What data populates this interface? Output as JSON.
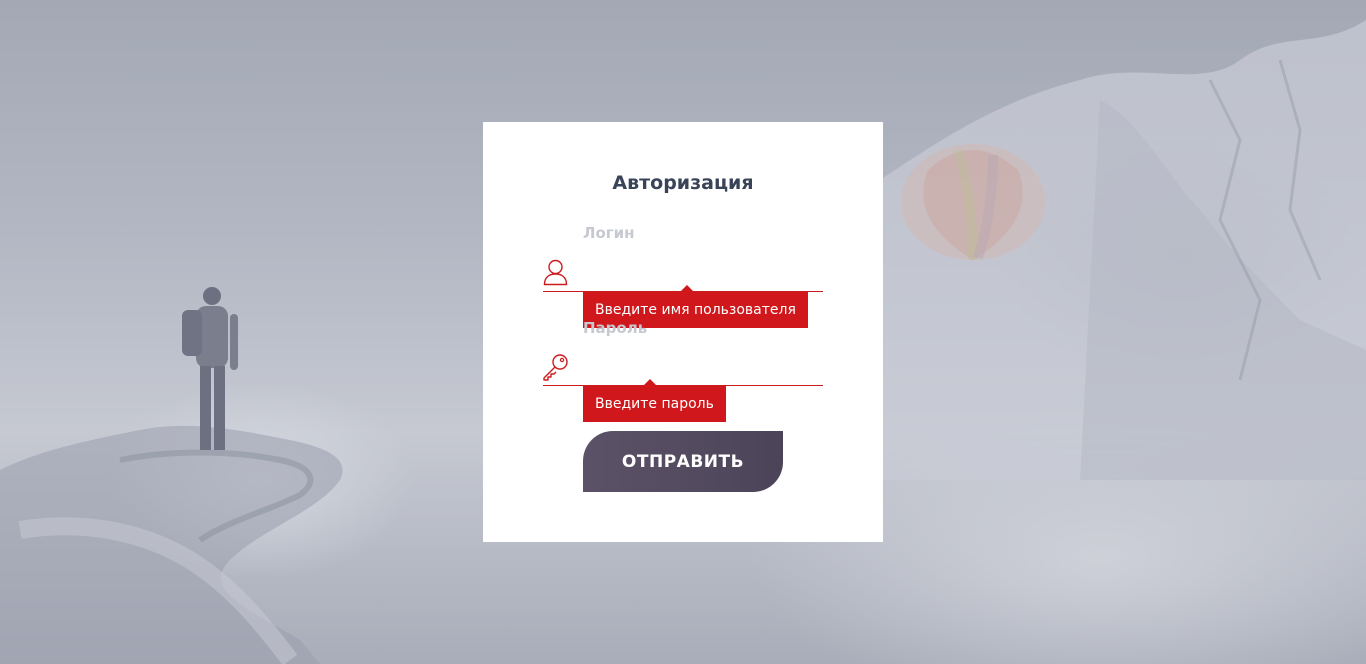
{
  "form": {
    "title": "Авторизация",
    "login": {
      "label": "Логин",
      "value": "",
      "error": "Введите имя пользователя",
      "icon": "user-icon"
    },
    "password": {
      "label": "Пароль",
      "value": "",
      "error": "Введите пароль",
      "icon": "key-icon"
    },
    "submit_label": "ОТПРАВИТЬ"
  },
  "colors": {
    "accent_error": "#d0171b",
    "title": "#3a4459",
    "button": "#544b60",
    "label": "#c6c9d0"
  }
}
